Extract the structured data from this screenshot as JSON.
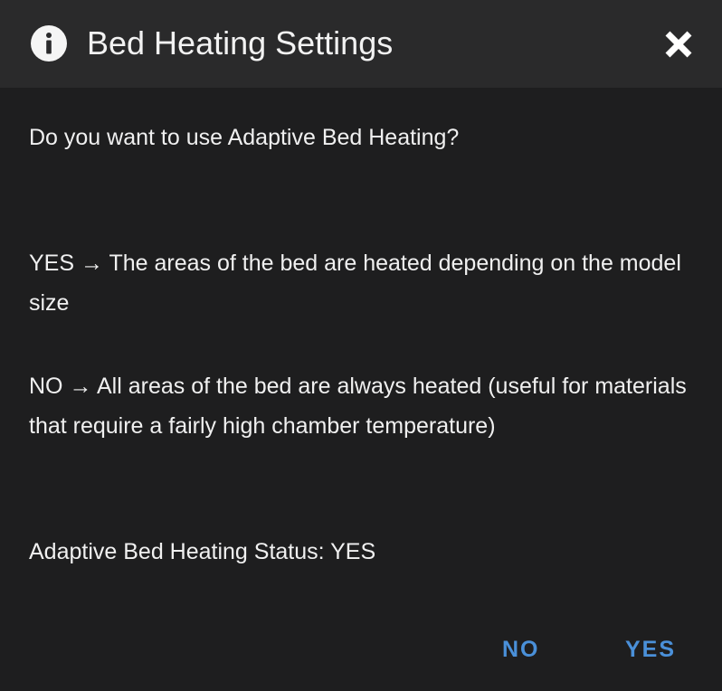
{
  "dialog": {
    "title": "Bed Heating Settings",
    "title_icon": "info-icon",
    "close_icon": "close-icon",
    "question": "Do you want to use Adaptive Bed Heating?",
    "yes_description": "YES → The areas of the bed are heated depending on the model size",
    "no_description": "NO → All areas of the bed are always heated (useful for materials that require a fairly high chamber temperature)",
    "status": "Adaptive Bed Heating Status: YES",
    "buttons": {
      "no_label": "NO",
      "yes_label": "YES"
    }
  },
  "colors": {
    "background": "#1e1e1f",
    "header_background": "#2a2a2b",
    "text": "#f0f0f0",
    "accent": "#4a90d9"
  }
}
